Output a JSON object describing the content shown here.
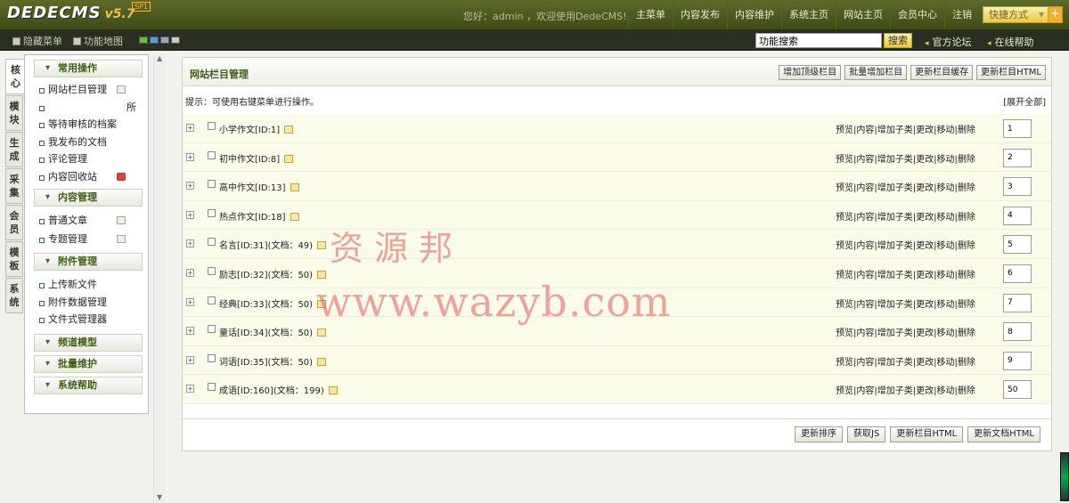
{
  "app": {
    "logo": "DEDECMS",
    "version": "v5.7",
    "sp": "SP1",
    "greeting": "您好：admin ，欢迎使用DedeCMS!",
    "topnav": [
      "主菜单",
      "内容发布",
      "内容维护",
      "系统主页",
      "网站主页",
      "会员中心",
      "注销"
    ],
    "quick_label": "快捷方式",
    "quick_plus": "+"
  },
  "subbar": {
    "hide_menu": "隐藏菜单",
    "func_map": "功能地图",
    "swatch_colors": [
      "#6bbf38",
      "#4aa3df",
      "#8fa8c8",
      "#c9c9c9"
    ],
    "search_value": "功能搜索",
    "search_button": "搜索",
    "forum": "官方论坛",
    "help": "在线帮助"
  },
  "vtabs": [
    "核心",
    "模块",
    "生成",
    "采集",
    "会员",
    "模板",
    "系统"
  ],
  "leftmenu": {
    "groups": [
      {
        "title": "常用操作",
        "items": [
          {
            "label": "网站栏目管理"
          },
          {
            "label": ""
          },
          {
            "label": "所"
          },
          {
            "label": "等待审核的档案"
          },
          {
            "label": "我发布的文档"
          },
          {
            "label": "评论管理"
          },
          {
            "label": "内容回收站"
          }
        ]
      },
      {
        "title": "内容管理",
        "items": [
          {
            "label": "普通文章"
          },
          {
            "label": "专题管理"
          }
        ]
      },
      {
        "title": "附件管理",
        "items": [
          {
            "label": "上传新文件"
          },
          {
            "label": "附件数据管理"
          },
          {
            "label": "文件式管理器"
          }
        ]
      },
      {
        "title": "频道模型",
        "items": []
      },
      {
        "title": "批量维护",
        "items": []
      },
      {
        "title": "系统帮助",
        "items": []
      }
    ]
  },
  "main": {
    "title": "网站栏目管理",
    "buttons": [
      "增加顶级栏目",
      "批量增加栏目",
      "更新栏目缓存",
      "更新栏目HTML"
    ],
    "tip": "提示：可使用右键菜单进行操作。",
    "expand_all": "[展开全部]",
    "ops": "预览|内容|增加子类|更改|移动|删除",
    "rows": [
      {
        "name": "小学作文[ID:1]",
        "order": "1"
      },
      {
        "name": "初中作文[ID:8]",
        "order": "2"
      },
      {
        "name": "高中作文[ID:13]",
        "order": "3"
      },
      {
        "name": "热点作文[ID:18]",
        "order": "4"
      },
      {
        "name": "名言[ID:31](文档：49)",
        "order": "5"
      },
      {
        "name": "励志[ID:32](文档：50)",
        "order": "6"
      },
      {
        "name": "经典[ID:33](文档：50)",
        "order": "7"
      },
      {
        "name": "童话[ID:34](文档：50)",
        "order": "8"
      },
      {
        "name": "词语[ID:35](文档：50)",
        "order": "9"
      },
      {
        "name": "成语[ID:160](文档：199)",
        "order": "50"
      }
    ],
    "footer_buttons": [
      "更新排序",
      "获取JS",
      "更新栏目HTML",
      "更新文档HTML"
    ]
  },
  "watermark": {
    "line1": "资源邦",
    "line2": "www.wazyb.com"
  }
}
